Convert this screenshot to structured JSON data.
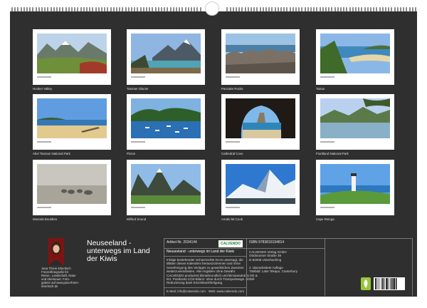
{
  "calendar": {
    "title": "Neuseeland - unterwegs im Land der Kiwis",
    "title_line1": "Neuseeland -",
    "title_line2": "unterwegs im Land",
    "title_line3": "der Kiwis"
  },
  "photos": [
    {
      "caption": "Hooker Valley",
      "icon": "mountain-valley"
    },
    {
      "caption": "Tasman Glacier",
      "icon": "glacier-lake"
    },
    {
      "caption": "Pancake Rocks",
      "icon": "rocky-coast"
    },
    {
      "caption": "Tairua",
      "icon": "bay-beach"
    },
    {
      "caption": "Abel Tasman National Park",
      "icon": "beach-driftwood"
    },
    {
      "caption": "Picton",
      "icon": "harbour-boats"
    },
    {
      "caption": "Cathedral Cove",
      "icon": "sea-arch"
    },
    {
      "caption": "Fiordland National Park",
      "icon": "fiord-lake"
    },
    {
      "caption": "Moeraki Boulders",
      "icon": "foggy-boulders"
    },
    {
      "caption": "Milford Sound",
      "icon": "fiord-peaks"
    },
    {
      "caption": "Aoraki Mt Cook",
      "icon": "snow-peak"
    },
    {
      "caption": "Cape Reinga",
      "icon": "lighthouse"
    }
  ],
  "author": {
    "name": "Jana Thiem-Eberitsch",
    "bio_lines": [
      "Freizeitfotografin für",
      "Reise-, Landschaft, Natur",
      "und Abenteuer. Foto-",
      "galerie auf www.jana-thiem-",
      "eberitsch.de"
    ]
  },
  "product": {
    "article": "Artikel-Nr. 2034144",
    "publisher_logo": "CALVENDO",
    "title": "Neuseeland - unterwegs im Land der Kiwis",
    "description_lines": [
      "Infolge bestehender Schutzrechte ist es untersagt, die",
      "Blätter dieses Kalenders herauszutrennen und ohne",
      "Genehmigung des Verlages zu gewerblichen Zwecken",
      "weiterzuverarbeiten. Alle Angaben ohne Gewähr.",
      "CALVENDO produziert klimafreundlich und klimaneutral in DE &",
      "EU. Postkonto CO2-Bilanz: ohne durch Transportwege. Abfall-",
      "Reduzierung dank Einzelstückfertigung."
    ],
    "contact": "E-Mail: info@calvendo.com · Web: www.calvendo.com"
  },
  "publisher": {
    "isbn": "ISBN 9783816194814",
    "name": "CALVENDO Verlag GmbH",
    "street": "Ottobrunner Straße 39",
    "city": "D-82008 Unterhaching",
    "edition": "2. überarbeitete Auflage",
    "cover_note": "Titelbild: Lake Tekapo, Canterbury"
  }
}
